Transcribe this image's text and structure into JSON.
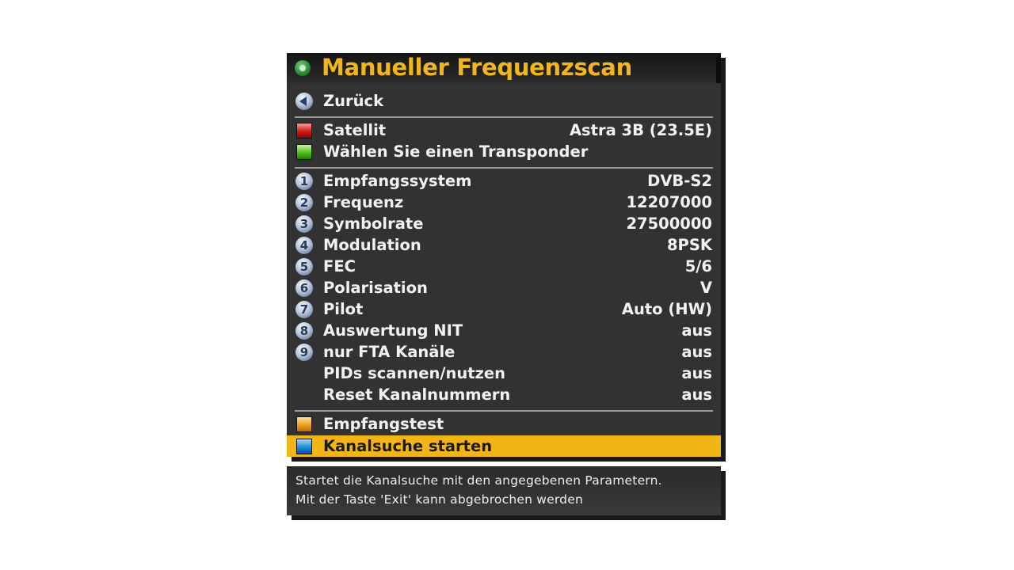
{
  "menu": {
    "title": "Manueller Frequenzscan",
    "back": {
      "label": "Zurück"
    },
    "satellite": {
      "label": "Satellit",
      "value": "Astra 3B (23.5E)"
    },
    "transponder": {
      "label": "Wählen Sie einen Transponder"
    },
    "params": [
      {
        "num": "1",
        "label": "Empfangssystem",
        "value": "DVB-S2"
      },
      {
        "num": "2",
        "label": "Frequenz",
        "value": "12207000"
      },
      {
        "num": "3",
        "label": "Symbolrate",
        "value": "27500000"
      },
      {
        "num": "4",
        "label": "Modulation",
        "value": "8PSK"
      },
      {
        "num": "5",
        "label": "FEC",
        "value": "5/6"
      },
      {
        "num": "6",
        "label": "Polarisation",
        "value": "V"
      },
      {
        "num": "7",
        "label": "Pilot",
        "value": "Auto (HW)"
      },
      {
        "num": "8",
        "label": "Auswertung NIT",
        "value": "aus"
      },
      {
        "num": "9",
        "label": "nur FTA Kanäle",
        "value": "aus"
      }
    ],
    "pids": {
      "label": "PIDs scannen/nutzen",
      "value": "aus"
    },
    "reset": {
      "label": "Reset Kanalnummern",
      "value": "aus"
    },
    "test": {
      "label": "Empfangstest"
    },
    "start": {
      "label": "Kanalsuche starten"
    }
  },
  "info": {
    "line1": "Startet die Kanalsuche mit den angegebenen Parametern.",
    "line2": "Mit der Taste 'Exit' kann abgebrochen werden"
  },
  "colors": {
    "accent": "#f2b516",
    "panel": "#323232",
    "red_key": "#d11b1b",
    "green_key": "#4fc11b",
    "yellow_key": "#f0a21b",
    "blue_key": "#1b8cdb"
  },
  "icons": [
    "gear-icon",
    "back-arrow-icon",
    "red-key-icon",
    "green-key-icon",
    "number-key-icon",
    "yellow-key-icon",
    "blue-key-icon"
  ]
}
